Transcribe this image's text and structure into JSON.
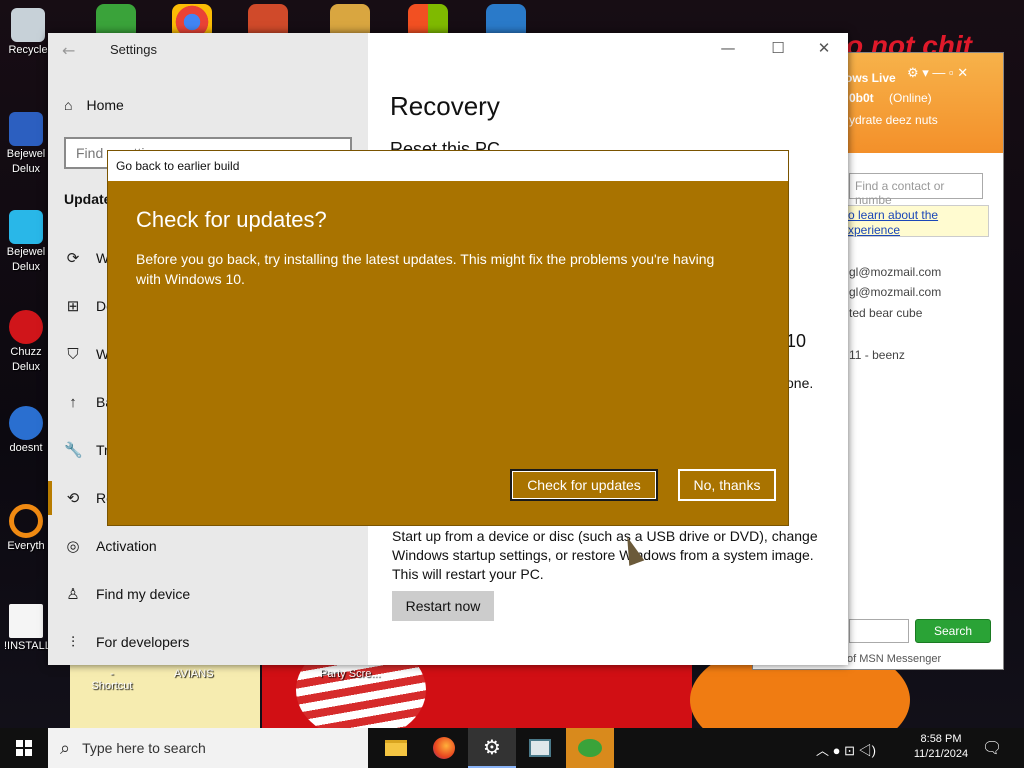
{
  "desktop": {
    "icons": [
      {
        "label": "Recycle",
        "name": "recycle-bin-icon"
      },
      {
        "label": "Bejewel",
        "label2": "Delux",
        "name": "bejeweled-icon"
      },
      {
        "label": "Bejewel",
        "label2": "Delux",
        "name": "bejeweled-deluxe-icon"
      },
      {
        "label": "Chuzz",
        "label2": "Delux",
        "name": "chuzzle-icon"
      },
      {
        "label": "doesnt",
        "name": "shortcut-icon"
      },
      {
        "label": "Everyth",
        "name": "everything-icon"
      },
      {
        "label": "!INSTALL",
        "name": "install-file-icon"
      }
    ],
    "bottom_labels": [
      "- Shortcut",
      "AVIANS",
      "Party Scre..."
    ],
    "wallpaper_text": "o not chit"
  },
  "settings": {
    "window_title": "Settings",
    "home": "Home",
    "search_placeholder": "Find a setting",
    "section": "Update",
    "nav": [
      {
        "label": "W",
        "icon": "refresh-icon"
      },
      {
        "label": "De",
        "icon": "delivery-optimization-icon"
      },
      {
        "label": "W",
        "icon": "shield-icon"
      },
      {
        "label": "Ba",
        "icon": "backup-icon"
      },
      {
        "label": "Tr",
        "icon": "troubleshoot-icon"
      },
      {
        "label": "Re",
        "icon": "recovery-icon"
      },
      {
        "label": "Activation",
        "icon": "activation-icon"
      },
      {
        "label": "Find my device",
        "icon": "find-device-icon"
      },
      {
        "label": "For developers",
        "icon": "developers-icon"
      }
    ],
    "main": {
      "title": "Recovery",
      "subtitle": "Reset this PC",
      "frag1": "10",
      "frag2": "one.",
      "advanced_text": "Start up from a device or disc (such as a USB drive or DVD), change Windows startup settings, or restore Windows from a system image. This will restart your PC.",
      "restart_button": "Restart now"
    }
  },
  "msn": {
    "title": "ows Live",
    "user": "0b0t",
    "status": "(Online)",
    "message": "ydrate deez nuts",
    "search_placeholder": "Find a contact or numbe",
    "link_line1": "o learn about the",
    "link_line2": "xperience",
    "contacts": [
      "gl@mozmail.com",
      "gl@mozmail.com",
      "ted bear cube",
      "11 - beenz"
    ],
    "search_button": "Search",
    "footer": "of MSN Messenger"
  },
  "dialog": {
    "title": "Go back to earlier build",
    "heading": "Check for updates?",
    "body": "Before you go back, try installing the latest updates. This might fix the problems you're having with Windows 10.",
    "primary_button": "Check for updates",
    "secondary_button": "No, thanks",
    "accent": "#a97300"
  },
  "taskbar": {
    "search_placeholder": "Type here to search",
    "time": "8:58 PM",
    "date": "11/21/2024"
  }
}
